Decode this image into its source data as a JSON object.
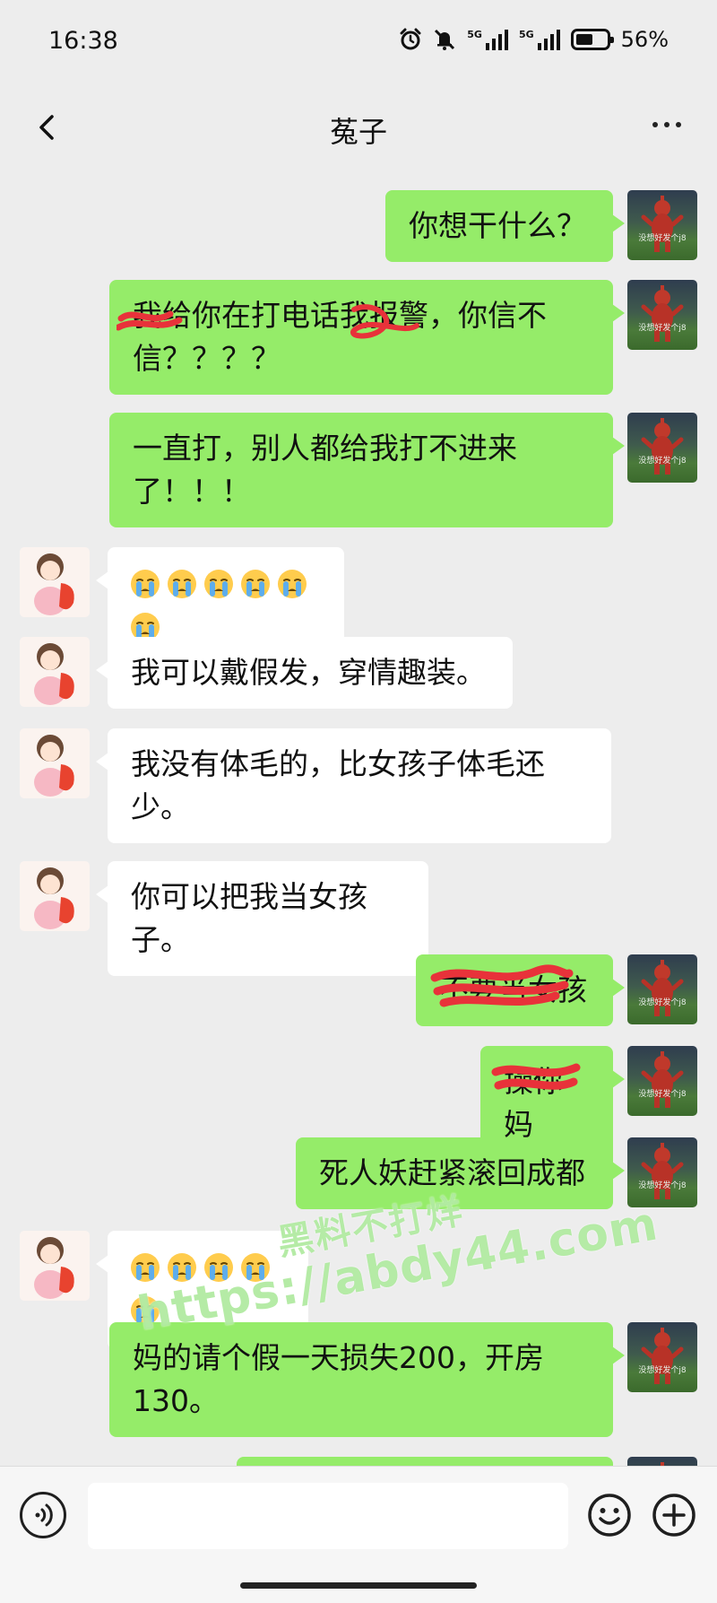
{
  "status_bar": {
    "time": "16:38",
    "signal_label_1": "5G",
    "signal_label_2": "5G",
    "battery_level": 0.56,
    "battery_text": "56%",
    "icons": [
      "alarm-icon",
      "mute-bell-icon",
      "signal-5g-icon",
      "signal-5g-icon",
      "battery-icon"
    ]
  },
  "nav": {
    "title": "菟子",
    "back_icon": "chevron-left-icon",
    "more_icon": "more-dots-icon"
  },
  "avatars": {
    "sent_caption": "没想好发个j8"
  },
  "messages": [
    {
      "side": "sent",
      "text": "你想干什么？"
    },
    {
      "side": "sent",
      "text": "我给你在打电话我报警，你信不信？？？？"
    },
    {
      "side": "sent",
      "text": "一直打，别人都给我打不进来了！！！"
    },
    {
      "side": "recv",
      "emoji_count": 6,
      "emoji": "crying-face"
    },
    {
      "side": "recv",
      "text": "我可以戴假发，穿情趣装。"
    },
    {
      "side": "recv",
      "text": "我没有体毛的，比女孩子体毛还少。"
    },
    {
      "side": "recv",
      "text": "你可以把我当女孩子。"
    },
    {
      "side": "sent",
      "text": "不要当女孩"
    },
    {
      "side": "sent",
      "text": "操你妈"
    },
    {
      "side": "sent",
      "text": "死人妖赶紧滚回成都"
    },
    {
      "side": "recv",
      "emoji_count": 5,
      "emoji": "crying-face"
    },
    {
      "side": "sent",
      "text": "妈的请个假一天损失200，开房130。"
    }
  ],
  "watermark": {
    "line1": "黑料不打烊",
    "line2": "https://abdy44.com"
  },
  "input_bar": {
    "voice_icon": "voice-icon",
    "emoji_icon": "smiley-icon",
    "add_icon": "plus-circle-icon"
  }
}
